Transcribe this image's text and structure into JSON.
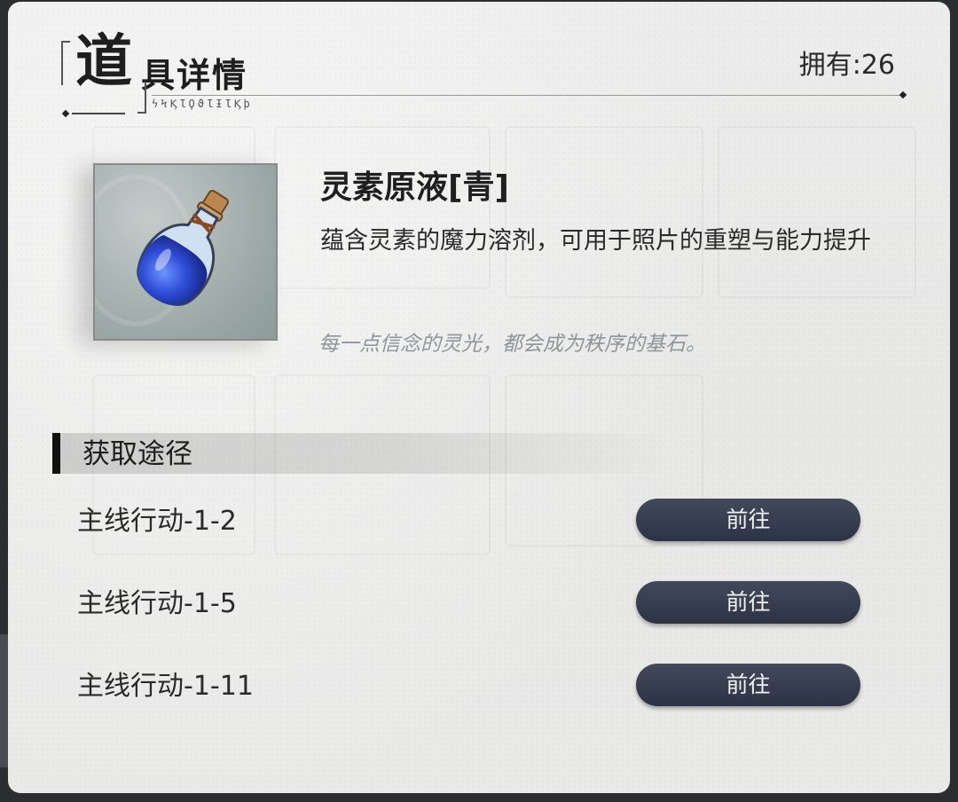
{
  "header": {
    "title_first_char": "道",
    "title_rest": "具详情",
    "runes": "ϟϞϏƖϘϑƖƗƖϏϸ",
    "owned_label": "拥有:26"
  },
  "item": {
    "name": "灵素原液[青]",
    "description": "蕴含灵素的魔力溶剂，可用于照片的重塑与能力提升",
    "quote": "每一点信念的灵光，都会成为秩序的基石。",
    "icon": "blue-potion-bottle-icon"
  },
  "acquire": {
    "section_title": "获取途径",
    "routes": [
      {
        "label": "主线行动-1-2",
        "button": "前往"
      },
      {
        "label": "主线行动-1-5",
        "button": "前往"
      },
      {
        "label": "主线行动-1-11",
        "button": "前往"
      }
    ]
  },
  "colors": {
    "button_bg": "#343b4c",
    "panel_bg": "#e9e9e8",
    "quote": "#8e959b",
    "potion_blue": "#2f4fd8"
  }
}
